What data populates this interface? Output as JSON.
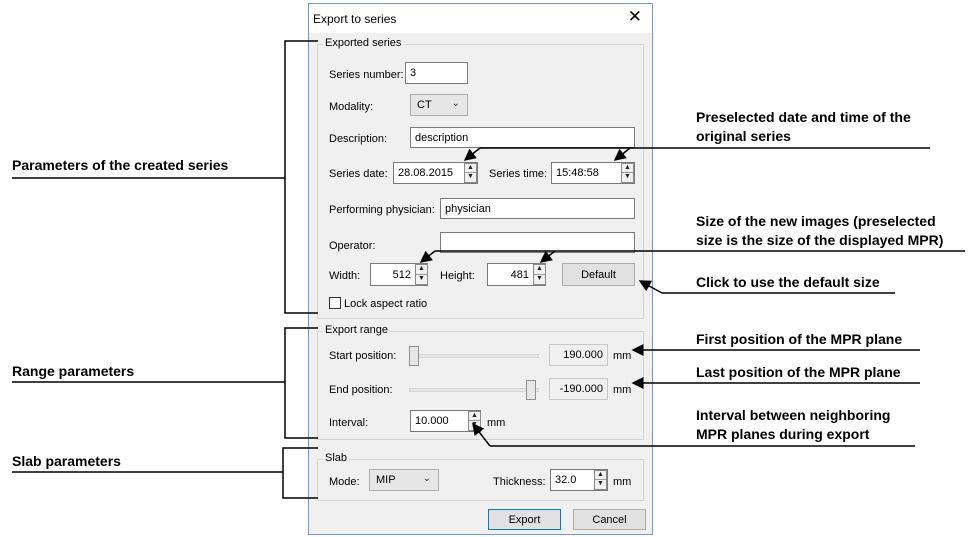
{
  "dialog": {
    "title": "Export to series",
    "close_glyph": "✕",
    "exported_series": {
      "legend": "Exported series",
      "series_number_label": "Series number:",
      "series_number_value": "3",
      "modality_label": "Modality:",
      "modality_value": "CT",
      "description_label": "Description:",
      "description_value": "description",
      "series_date_label": "Series date:",
      "series_date_value": "28.08.2015",
      "series_time_label": "Series time:",
      "series_time_value": "15:48:58",
      "physician_label": "Performing physician:",
      "physician_value": "physician",
      "operator_label": "Operator:",
      "operator_value": "",
      "width_label": "Width:",
      "width_value": "512",
      "height_label": "Height:",
      "height_value": "481",
      "default_button": "Default",
      "lock_aspect_label": "Lock aspect ratio",
      "lock_aspect_checked": false
    },
    "export_range": {
      "legend": "Export range",
      "start_label": "Start position:",
      "start_value": "190.000",
      "start_slider_fraction": 0.0,
      "end_label": "End position:",
      "end_value": "-190.000",
      "end_slider_fraction": 1.0,
      "interval_label": "Interval:",
      "interval_value": "10.000",
      "unit": "mm"
    },
    "slab": {
      "legend": "Slab",
      "mode_label": "Mode:",
      "mode_value": "MIP",
      "thickness_label": "Thickness:",
      "thickness_value": "32.0",
      "unit": "mm"
    },
    "export_button": "Export",
    "cancel_button": "Cancel",
    "accent_color": "#0078d7"
  },
  "annotations": {
    "params_created": "Parameters of the created series",
    "range_params": "Range parameters",
    "slab_params": "Slab parameters",
    "preselected_date_1": "Preselected date and time of the",
    "preselected_date_2": "original series",
    "size_new_1": "Size of the new images (preselected",
    "size_new_2": "size is the size of the displayed MPR)",
    "default_size": "Click to use the default size",
    "first_pos": "First position of the MPR plane",
    "last_pos": "Last position of the MPR plane",
    "interval_1": "Interval between neighboring",
    "interval_2": "MPR planes during export"
  }
}
